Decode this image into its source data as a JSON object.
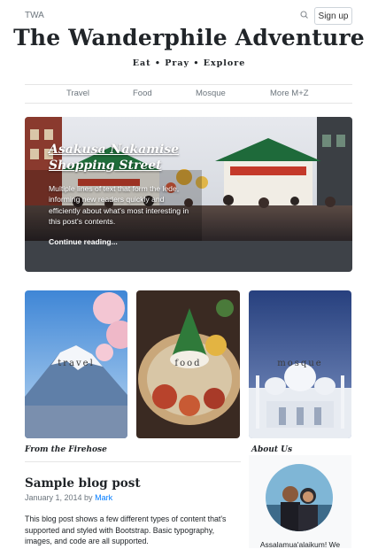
{
  "header": {
    "brand": "TWA",
    "signup_label": "Sign up",
    "title": "The Wanderphile Adventure",
    "tagline": "Eat  •  Pray  •  Explore"
  },
  "nav": {
    "items": [
      "Travel",
      "Food",
      "Mosque",
      "More M+Z"
    ]
  },
  "featured": {
    "title_line1": "Asakusa Nakamise",
    "title_line2": "Shopping Street",
    "lede": "Multiple lines of text that form the lede, informing new readers quickly and efficiently about what's most interesting in this post's contents.",
    "link": "Continue reading..."
  },
  "categories": [
    {
      "label": "travel"
    },
    {
      "label": "food"
    },
    {
      "label": "mosque"
    }
  ],
  "main": {
    "section_title": "From the Firehose",
    "post": {
      "title": "Sample blog post",
      "date": "January 1, 2014 by",
      "author": "Mark",
      "body": "This blog post shows a few different types of content that's supported and styled with Bootstrap. Basic typography, images, and code are all supported."
    }
  },
  "sidebar": {
    "about_title": "About Us",
    "about_text": "Assalamua'alaikum! We"
  },
  "colors": {
    "accent": "#007bff",
    "hero_dark": "#3e4248"
  }
}
